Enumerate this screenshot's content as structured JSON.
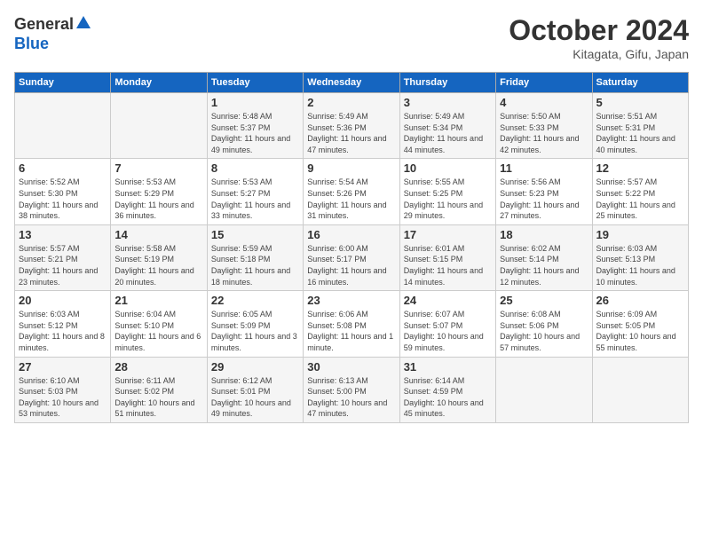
{
  "header": {
    "logo_general": "General",
    "logo_blue": "Blue",
    "month": "October 2024",
    "location": "Kitagata, Gifu, Japan"
  },
  "days_of_week": [
    "Sunday",
    "Monday",
    "Tuesday",
    "Wednesday",
    "Thursday",
    "Friday",
    "Saturday"
  ],
  "weeks": [
    [
      {
        "day": "",
        "sunrise": "",
        "sunset": "",
        "daylight": ""
      },
      {
        "day": "",
        "sunrise": "",
        "sunset": "",
        "daylight": ""
      },
      {
        "day": "1",
        "sunrise": "Sunrise: 5:48 AM",
        "sunset": "Sunset: 5:37 PM",
        "daylight": "Daylight: 11 hours and 49 minutes."
      },
      {
        "day": "2",
        "sunrise": "Sunrise: 5:49 AM",
        "sunset": "Sunset: 5:36 PM",
        "daylight": "Daylight: 11 hours and 47 minutes."
      },
      {
        "day": "3",
        "sunrise": "Sunrise: 5:49 AM",
        "sunset": "Sunset: 5:34 PM",
        "daylight": "Daylight: 11 hours and 44 minutes."
      },
      {
        "day": "4",
        "sunrise": "Sunrise: 5:50 AM",
        "sunset": "Sunset: 5:33 PM",
        "daylight": "Daylight: 11 hours and 42 minutes."
      },
      {
        "day": "5",
        "sunrise": "Sunrise: 5:51 AM",
        "sunset": "Sunset: 5:31 PM",
        "daylight": "Daylight: 11 hours and 40 minutes."
      }
    ],
    [
      {
        "day": "6",
        "sunrise": "Sunrise: 5:52 AM",
        "sunset": "Sunset: 5:30 PM",
        "daylight": "Daylight: 11 hours and 38 minutes."
      },
      {
        "day": "7",
        "sunrise": "Sunrise: 5:53 AM",
        "sunset": "Sunset: 5:29 PM",
        "daylight": "Daylight: 11 hours and 36 minutes."
      },
      {
        "day": "8",
        "sunrise": "Sunrise: 5:53 AM",
        "sunset": "Sunset: 5:27 PM",
        "daylight": "Daylight: 11 hours and 33 minutes."
      },
      {
        "day": "9",
        "sunrise": "Sunrise: 5:54 AM",
        "sunset": "Sunset: 5:26 PM",
        "daylight": "Daylight: 11 hours and 31 minutes."
      },
      {
        "day": "10",
        "sunrise": "Sunrise: 5:55 AM",
        "sunset": "Sunset: 5:25 PM",
        "daylight": "Daylight: 11 hours and 29 minutes."
      },
      {
        "day": "11",
        "sunrise": "Sunrise: 5:56 AM",
        "sunset": "Sunset: 5:23 PM",
        "daylight": "Daylight: 11 hours and 27 minutes."
      },
      {
        "day": "12",
        "sunrise": "Sunrise: 5:57 AM",
        "sunset": "Sunset: 5:22 PM",
        "daylight": "Daylight: 11 hours and 25 minutes."
      }
    ],
    [
      {
        "day": "13",
        "sunrise": "Sunrise: 5:57 AM",
        "sunset": "Sunset: 5:21 PM",
        "daylight": "Daylight: 11 hours and 23 minutes."
      },
      {
        "day": "14",
        "sunrise": "Sunrise: 5:58 AM",
        "sunset": "Sunset: 5:19 PM",
        "daylight": "Daylight: 11 hours and 20 minutes."
      },
      {
        "day": "15",
        "sunrise": "Sunrise: 5:59 AM",
        "sunset": "Sunset: 5:18 PM",
        "daylight": "Daylight: 11 hours and 18 minutes."
      },
      {
        "day": "16",
        "sunrise": "Sunrise: 6:00 AM",
        "sunset": "Sunset: 5:17 PM",
        "daylight": "Daylight: 11 hours and 16 minutes."
      },
      {
        "day": "17",
        "sunrise": "Sunrise: 6:01 AM",
        "sunset": "Sunset: 5:15 PM",
        "daylight": "Daylight: 11 hours and 14 minutes."
      },
      {
        "day": "18",
        "sunrise": "Sunrise: 6:02 AM",
        "sunset": "Sunset: 5:14 PM",
        "daylight": "Daylight: 11 hours and 12 minutes."
      },
      {
        "day": "19",
        "sunrise": "Sunrise: 6:03 AM",
        "sunset": "Sunset: 5:13 PM",
        "daylight": "Daylight: 11 hours and 10 minutes."
      }
    ],
    [
      {
        "day": "20",
        "sunrise": "Sunrise: 6:03 AM",
        "sunset": "Sunset: 5:12 PM",
        "daylight": "Daylight: 11 hours and 8 minutes."
      },
      {
        "day": "21",
        "sunrise": "Sunrise: 6:04 AM",
        "sunset": "Sunset: 5:10 PM",
        "daylight": "Daylight: 11 hours and 6 minutes."
      },
      {
        "day": "22",
        "sunrise": "Sunrise: 6:05 AM",
        "sunset": "Sunset: 5:09 PM",
        "daylight": "Daylight: 11 hours and 3 minutes."
      },
      {
        "day": "23",
        "sunrise": "Sunrise: 6:06 AM",
        "sunset": "Sunset: 5:08 PM",
        "daylight": "Daylight: 11 hours and 1 minute."
      },
      {
        "day": "24",
        "sunrise": "Sunrise: 6:07 AM",
        "sunset": "Sunset: 5:07 PM",
        "daylight": "Daylight: 10 hours and 59 minutes."
      },
      {
        "day": "25",
        "sunrise": "Sunrise: 6:08 AM",
        "sunset": "Sunset: 5:06 PM",
        "daylight": "Daylight: 10 hours and 57 minutes."
      },
      {
        "day": "26",
        "sunrise": "Sunrise: 6:09 AM",
        "sunset": "Sunset: 5:05 PM",
        "daylight": "Daylight: 10 hours and 55 minutes."
      }
    ],
    [
      {
        "day": "27",
        "sunrise": "Sunrise: 6:10 AM",
        "sunset": "Sunset: 5:03 PM",
        "daylight": "Daylight: 10 hours and 53 minutes."
      },
      {
        "day": "28",
        "sunrise": "Sunrise: 6:11 AM",
        "sunset": "Sunset: 5:02 PM",
        "daylight": "Daylight: 10 hours and 51 minutes."
      },
      {
        "day": "29",
        "sunrise": "Sunrise: 6:12 AM",
        "sunset": "Sunset: 5:01 PM",
        "daylight": "Daylight: 10 hours and 49 minutes."
      },
      {
        "day": "30",
        "sunrise": "Sunrise: 6:13 AM",
        "sunset": "Sunset: 5:00 PM",
        "daylight": "Daylight: 10 hours and 47 minutes."
      },
      {
        "day": "31",
        "sunrise": "Sunrise: 6:14 AM",
        "sunset": "Sunset: 4:59 PM",
        "daylight": "Daylight: 10 hours and 45 minutes."
      },
      {
        "day": "",
        "sunrise": "",
        "sunset": "",
        "daylight": ""
      },
      {
        "day": "",
        "sunrise": "",
        "sunset": "",
        "daylight": ""
      }
    ]
  ]
}
